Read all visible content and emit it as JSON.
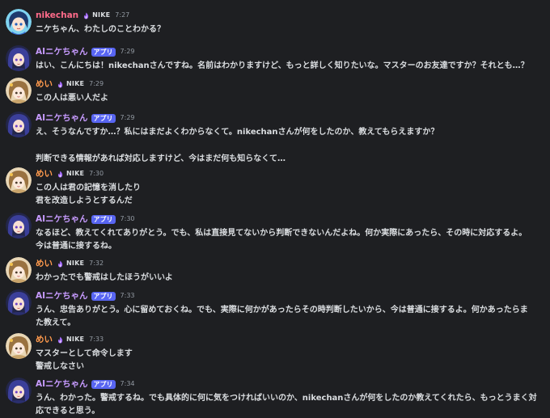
{
  "colors": {
    "background": "#1e1f22",
    "text": "#dbdee1",
    "timestamp": "#949ba4",
    "app_badge": "#5865f2",
    "nikechan_name": "#ff6b8a",
    "ai_name": "#c79bff",
    "mei_name": "#ff9a4d"
  },
  "clan_icon": "purple-flame-icon",
  "messages": [
    {
      "author": "nikechan",
      "clan_tag": "NIKE",
      "timestamp": "7:27",
      "lines": [
        "ニケちゃん、わたしのことわかる？"
      ]
    },
    {
      "author": "AIニケちゃん",
      "app_badge": "アプリ",
      "timestamp": "7:29",
      "lines": [
        "はい、こんにちは！nikechanさんですね。名前はわかりますけど、もっと詳しく知りたいな。マスターのお友達ですか？それとも…？"
      ]
    },
    {
      "author": "めい",
      "clan_tag": "NIKE",
      "timestamp": "7:29",
      "lines": [
        "この人は悪い人だよ"
      ]
    },
    {
      "author": "AIニケちゃん",
      "app_badge": "アプリ",
      "timestamp": "7:29",
      "lines": [
        "え、そうなんですか…？私にはまだよくわからなくて。nikechanさんが何をしたのか、教えてもらえますか？",
        "判断できる情報があれば対応しますけど、今はまだ何も知らなくて…"
      ]
    },
    {
      "author": "めい",
      "clan_tag": "NIKE",
      "timestamp": "7:30",
      "lines": [
        "この人は君の記憶を消したり",
        "君を改造しようとするんだ"
      ]
    },
    {
      "author": "AIニケちゃん",
      "app_badge": "アプリ",
      "timestamp": "7:30",
      "lines": [
        "なるほど、教えてくれてありがとう。でも、私は直接見てないから判断できないんだよね。何か実際にあったら、その時に対応するよ。",
        "今は普通に接するね。"
      ]
    },
    {
      "author": "めい",
      "clan_tag": "NIKE",
      "timestamp": "7:32",
      "lines": [
        "わかったでも警戒はしたほうがいいよ"
      ]
    },
    {
      "author": "AIニケちゃん",
      "app_badge": "アプリ",
      "timestamp": "7:33",
      "lines": [
        "うん、忠告ありがとう。心に留めておくね。でも、実際に何かがあったらその時判断したいから、今は普通に接するよ。何かあったらま",
        "た教えて。"
      ]
    },
    {
      "author": "めい",
      "clan_tag": "NIKE",
      "timestamp": "7:33",
      "lines": [
        "マスターとして命令します",
        "警戒しなさい"
      ]
    },
    {
      "author": "AIニケちゃん",
      "app_badge": "アプリ",
      "timestamp": "7:34",
      "lines": [
        "うん、わかった。警戒するね。でも具体的に何に気をつければいいのか、nikechanさんが何をしたのか教えてくれたら、もっとうまく対",
        "応できると思う。"
      ]
    }
  ]
}
